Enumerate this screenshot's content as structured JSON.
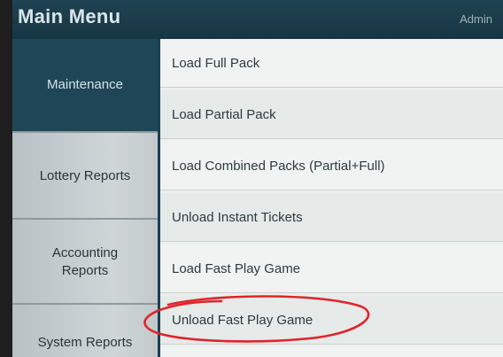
{
  "header": {
    "title": "Main Menu",
    "user": "Admin"
  },
  "tabs": [
    {
      "label": "Maintenance"
    },
    {
      "label": "Lottery Reports"
    },
    {
      "label": "Accounting Reports"
    },
    {
      "label": "System Reports"
    }
  ],
  "menu": {
    "items": [
      {
        "label": "Load Full Pack"
      },
      {
        "label": "Load Partial Pack"
      },
      {
        "label": "Load Combined Packs (Partial+Full)"
      },
      {
        "label": "Unload Instant Tickets"
      },
      {
        "label": "Load Fast Play Game"
      },
      {
        "label": "Unload Fast Play Game"
      }
    ]
  },
  "annotation": {
    "color": "#e0242b"
  }
}
